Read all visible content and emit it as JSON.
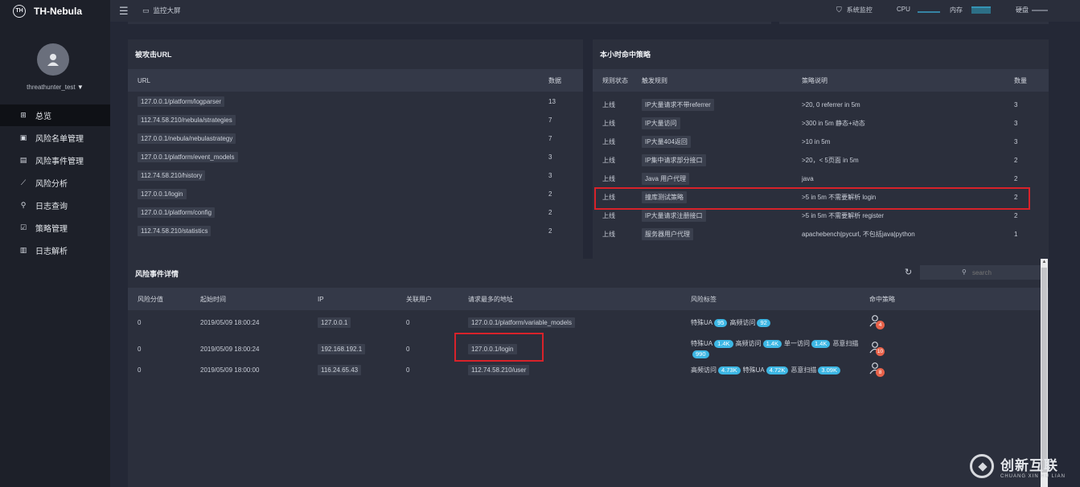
{
  "brand": {
    "name": "TH-Nebula",
    "logo_text": "TH"
  },
  "user": {
    "name": "threathunter_test",
    "caret": "▼"
  },
  "nav": [
    {
      "label": "总览",
      "icon": "dashboard-icon",
      "glyph": "⊞",
      "active": true
    },
    {
      "label": "风险名单管理",
      "icon": "picture-list-icon",
      "glyph": "▣",
      "active": false
    },
    {
      "label": "风险事件管理",
      "icon": "document-icon",
      "glyph": "▤",
      "active": false
    },
    {
      "label": "风险分析",
      "icon": "line-chart-icon",
      "glyph": "⟋",
      "active": false
    },
    {
      "label": "日志查询",
      "icon": "search-icon",
      "glyph": "⚲",
      "active": false
    },
    {
      "label": "策略管理",
      "icon": "strategy-icon",
      "glyph": "☑",
      "active": false
    },
    {
      "label": "日志解析",
      "icon": "file-icon",
      "glyph": "▥",
      "active": false
    }
  ],
  "topbar": {
    "menu_glyph": "☰",
    "monitor_label": "监控大屏",
    "sysmon_label": "系统监控",
    "cpu_label": "CPU",
    "mem_label": "内存",
    "disk_label": "硬盘"
  },
  "url_panel": {
    "title": "被攻击URL",
    "col_url": "URL",
    "col_count": "数据",
    "rows": [
      {
        "url": "127.0.0.1/platform/logparser",
        "count": "13"
      },
      {
        "url": "112.74.58.210/nebula/strategies",
        "count": "7"
      },
      {
        "url": "127.0.0.1/nebula/nebulastrategy",
        "count": "7"
      },
      {
        "url": "127.0.0.1/platform/event_models",
        "count": "3"
      },
      {
        "url": "112.74.58.210/history",
        "count": "3"
      },
      {
        "url": "127.0.0.1/login",
        "count": "2"
      },
      {
        "url": "127.0.0.1/platform/config",
        "count": "2"
      },
      {
        "url": "112.74.58.210/statistics",
        "count": "2"
      }
    ]
  },
  "strategy_panel": {
    "title": "本小时命中策略",
    "col_status": "规则状态",
    "col_rule": "触发规则",
    "col_desc": "策略说明",
    "col_count": "数量",
    "rows": [
      {
        "status": "上线",
        "rule": "IP大量请求不带referrer",
        "desc": ">20, 0 referrer in 5m",
        "count": "3"
      },
      {
        "status": "上线",
        "rule": "IP大量访问",
        "desc": ">300 in 5m 静态+动态",
        "count": "3"
      },
      {
        "status": "上线",
        "rule": "IP大量404返回",
        "desc": ">10 in 5m",
        "count": "3"
      },
      {
        "status": "上线",
        "rule": "IP集中请求部分接口",
        "desc": ">20，< 5页面 in 5m",
        "count": "2"
      },
      {
        "status": "上线",
        "rule": "Java 用户代理",
        "desc": "java",
        "count": "2"
      },
      {
        "status": "上线",
        "rule": "撞库测试策略",
        "desc": ">5 in 5m 不需要解析 login",
        "count": "2"
      },
      {
        "status": "上线",
        "rule": "IP大量请求注册接口",
        "desc": ">5 in 5m 不需要解析 register",
        "count": "2"
      },
      {
        "status": "上线",
        "rule": "服务器用户代理",
        "desc": "apachebench|pycurl, 不包括java|python",
        "count": "1"
      }
    ]
  },
  "events_panel": {
    "title": "风险事件详情",
    "search_placeholder": "search",
    "columns": {
      "score": "风险分值",
      "time": "起始时间",
      "ip": "IP",
      "users": "关联用户",
      "top_url": "请求最多的地址",
      "tags": "风险标签",
      "hits": "命中策略"
    },
    "rows": [
      {
        "score": "0",
        "time": "2019/05/09 18:00:24",
        "ip": "127.0.0.1",
        "users": "0",
        "top_url": "127.0.0.1/platform/variable_models",
        "tags": [
          {
            "name": "特殊UA",
            "value": "95"
          },
          {
            "name": "高频访问",
            "value": "92"
          }
        ],
        "hits": "4"
      },
      {
        "score": "0",
        "time": "2019/05/09 18:00:24",
        "ip": "192.168.192.1",
        "users": "0",
        "top_url": "127.0.0.1/login",
        "tags": [
          {
            "name": "特殊UA",
            "value": "1.4K"
          },
          {
            "name": "高频访问",
            "value": "1.4K"
          },
          {
            "name": "单一访问",
            "value": "1.4K"
          },
          {
            "name": "恶意扫描",
            "value": "990"
          }
        ],
        "hits": "10"
      },
      {
        "score": "0",
        "time": "2019/05/09 18:00:00",
        "ip": "116.24.65.43",
        "users": "0",
        "top_url": "112.74.58.210/user",
        "tags": [
          {
            "name": "高频访问",
            "value": "4.73K"
          },
          {
            "name": "特殊UA",
            "value": "4.72K"
          },
          {
            "name": "恶意扫描",
            "value": "3.09K"
          }
        ],
        "hits": "8"
      }
    ]
  },
  "watermark": {
    "cn": "创新互联",
    "en": "CHUANG XIN HU LIAN"
  }
}
